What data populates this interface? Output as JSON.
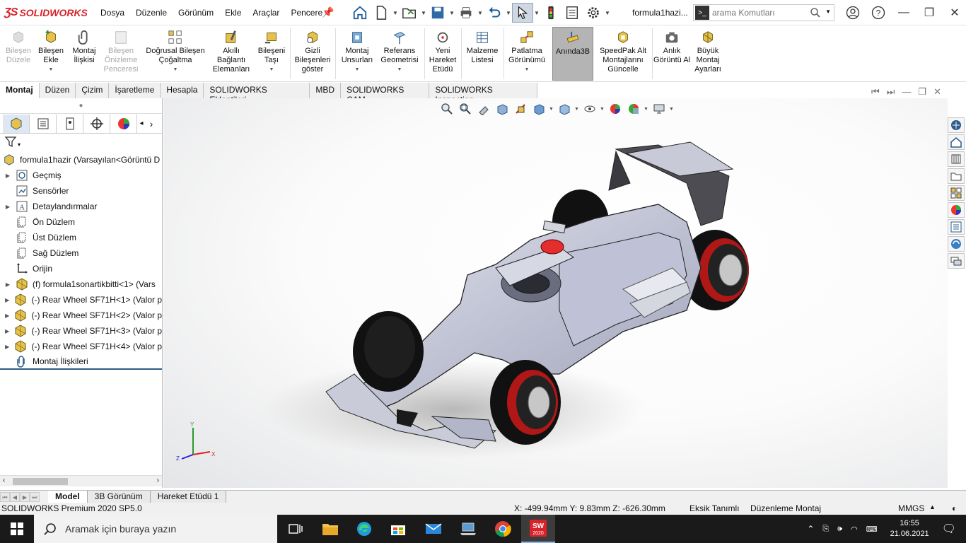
{
  "app": {
    "logo_text": "SOLIDWORKS",
    "doc_title": "formula1hazi...",
    "brand_color": "#d8232a"
  },
  "menu": [
    "Dosya",
    "Düzenle",
    "Görünüm",
    "Ekle",
    "Araçlar",
    "Pencere"
  ],
  "search": {
    "placeholder": "arama Komutları"
  },
  "ribbon": [
    {
      "label": "Bileşen Düzele",
      "disabled": true
    },
    {
      "label": "Bileşen Ekle",
      "disabled": false
    },
    {
      "label": "Montaj İlişkisi",
      "disabled": false
    },
    {
      "label": "Bileşen Önizleme Penceresi",
      "disabled": true
    },
    {
      "label": "Doğrusal Bileşen Çoğaltma",
      "disabled": false
    },
    {
      "label": "Akıllı Bağlantı Elemanları",
      "disabled": false
    },
    {
      "label": "Bileşeni Taşı",
      "disabled": false
    },
    {
      "label": "Gizli Bileşenleri göster",
      "disabled": false
    },
    {
      "label": "Montaj Unsurları",
      "disabled": false
    },
    {
      "label": "Referans Geometrisi",
      "disabled": false
    },
    {
      "label": "Yeni Hareket Etüdü",
      "disabled": false
    },
    {
      "label": "Malzeme Listesi",
      "disabled": false
    },
    {
      "label": "Patlatma Görünümü",
      "disabled": false
    },
    {
      "label": "Anında3B",
      "disabled": false,
      "active": true
    },
    {
      "label": "SpeedPak Alt Montajlarını Güncelle",
      "disabled": false
    },
    {
      "label": "Anlık Görüntü Al",
      "disabled": false
    },
    {
      "label": "Büyük Montaj Ayarları",
      "disabled": false
    }
  ],
  "tabs": [
    "Montaj",
    "Düzen",
    "Çizim",
    "İşaretleme",
    "Hesapla",
    "SOLIDWORKS Eklentileri",
    "MBD",
    "SOLIDWORKS CAM",
    "SOLIDWORKS Inspection"
  ],
  "tree": {
    "root": "formula1hazir  (Varsayılan<Görüntü D",
    "items": [
      {
        "label": "Geçmiş",
        "icon": "history-icon",
        "expandable": true
      },
      {
        "label": "Sensörler",
        "icon": "sensor-icon",
        "expandable": false
      },
      {
        "label": "Detaylandırmalar",
        "icon": "annotation-icon",
        "expandable": true
      },
      {
        "label": "Ön Düzlem",
        "icon": "plane-icon",
        "expandable": false
      },
      {
        "label": "Üst Düzlem",
        "icon": "plane-icon",
        "expandable": false
      },
      {
        "label": "Sağ Düzlem",
        "icon": "plane-icon",
        "expandable": false
      },
      {
        "label": "Orijin",
        "icon": "origin-icon",
        "expandable": false
      },
      {
        "label": "(f) formula1sonartikbitti<1> (Vars",
        "icon": "part-icon",
        "expandable": true
      },
      {
        "label": "(-) Rear Wheel SF71H<1> (Valor p",
        "icon": "part-icon",
        "expandable": true
      },
      {
        "label": "(-) Rear Wheel SF71H<2> (Valor p",
        "icon": "part-icon",
        "expandable": true
      },
      {
        "label": "(-) Rear Wheel SF71H<3> (Valor p",
        "icon": "part-icon",
        "expandable": true
      },
      {
        "label": "(-) Rear Wheel SF71H<4> (Valor p",
        "icon": "part-icon",
        "expandable": true
      },
      {
        "label": "Montaj İlişkileri",
        "icon": "mate-icon",
        "expandable": false
      }
    ]
  },
  "bottom_tabs": [
    "Model",
    "3B Görünüm",
    "Hareket Etüdü 1"
  ],
  "status": {
    "product": "SOLIDWORKS Premium 2020 SP5.0",
    "coords": "X: -499.94mm Y: 9.83mm Z: -626.30mm",
    "defined": "Eksik Tanımlı",
    "mode": "Düzenleme Montaj",
    "units": "MMGS"
  },
  "triad": {
    "x": "X",
    "y": "Y",
    "z": "Z"
  },
  "taskbar": {
    "search_placeholder": "Aramak için buraya yazın",
    "time": "16:55",
    "date": "21.06.2021",
    "sw_label": "2020"
  }
}
